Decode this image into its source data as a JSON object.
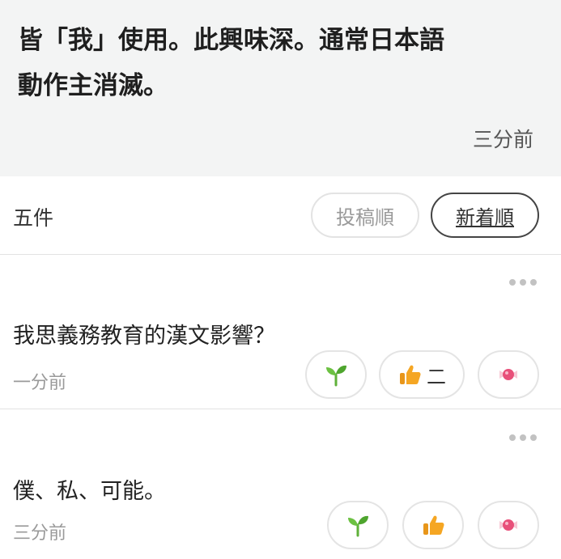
{
  "top_comment": {
    "line1": "皆「我」使用。此興味深。通常日本語",
    "line2": "動作主消滅。",
    "time": "三分前"
  },
  "sort_bar": {
    "count": "五件",
    "posted_order_label": "投稿順",
    "newest_order_label": "新着順"
  },
  "comments": [
    {
      "text": "我思義務教育的漢文影響？",
      "time": "一分前",
      "like_count": "二",
      "icons": [
        "sprout-icon",
        "thumbs-up-icon",
        "candy-icon"
      ]
    },
    {
      "text": "僕、私、可能。",
      "time": "三分前",
      "like_count": "",
      "icons": [
        "sprout-icon",
        "thumbs-up-icon",
        "candy-icon"
      ]
    }
  ],
  "colors": {
    "top_background": "#f3f4f4",
    "sprout": "#5fb13a",
    "thumb": "#f5a623",
    "candy": "#e8507a"
  }
}
